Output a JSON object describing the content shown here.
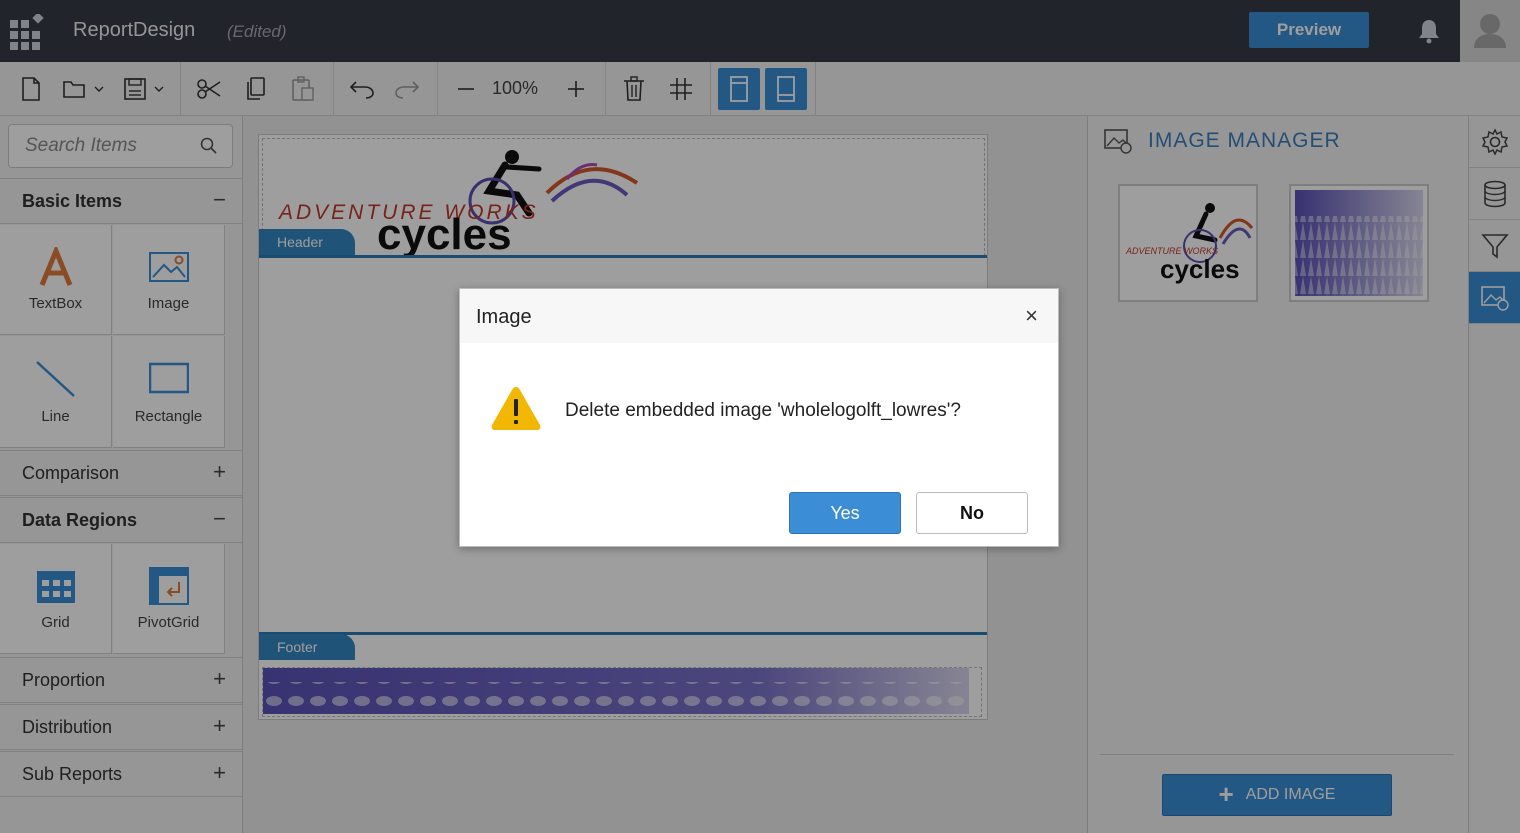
{
  "app": {
    "title": "ReportDesign",
    "status": "(Edited)",
    "preview_label": "Preview"
  },
  "toolbar": {
    "zoom": "100%"
  },
  "left_panel": {
    "search_placeholder": "Search Items",
    "sections": {
      "basic_items": {
        "label": "Basic Items",
        "toggle": "−"
      },
      "comparison": {
        "label": "Comparison",
        "toggle": "+"
      },
      "data_regions": {
        "label": "Data Regions",
        "toggle": "−"
      },
      "proportion": {
        "label": "Proportion",
        "toggle": "+"
      },
      "distribution": {
        "label": "Distribution",
        "toggle": "+"
      },
      "sub_reports": {
        "label": "Sub Reports",
        "toggle": "+"
      }
    },
    "basic_tiles": [
      "TextBox",
      "Image",
      "Line",
      "Rectangle"
    ],
    "data_region_tiles": [
      "Grid",
      "PivotGrid"
    ]
  },
  "canvas": {
    "header_label": "Header",
    "footer_label": "Footer",
    "logo_line1": "ADVENTURE WORKS",
    "logo_line2": "cycles"
  },
  "image_manager": {
    "title": "IMAGE MANAGER",
    "add_label": "ADD IMAGE",
    "thumb_logo_line1": "ADVENTURE WORKS",
    "thumb_logo_line2": "cycles"
  },
  "dialog": {
    "title": "Image",
    "close": "×",
    "message": "Delete embedded image 'wholelogolft_lowres'?",
    "yes": "Yes",
    "no": "No"
  },
  "colors": {
    "accent": "#3b8ed6",
    "topbar": "#363a44",
    "warning": "#f2b705"
  }
}
